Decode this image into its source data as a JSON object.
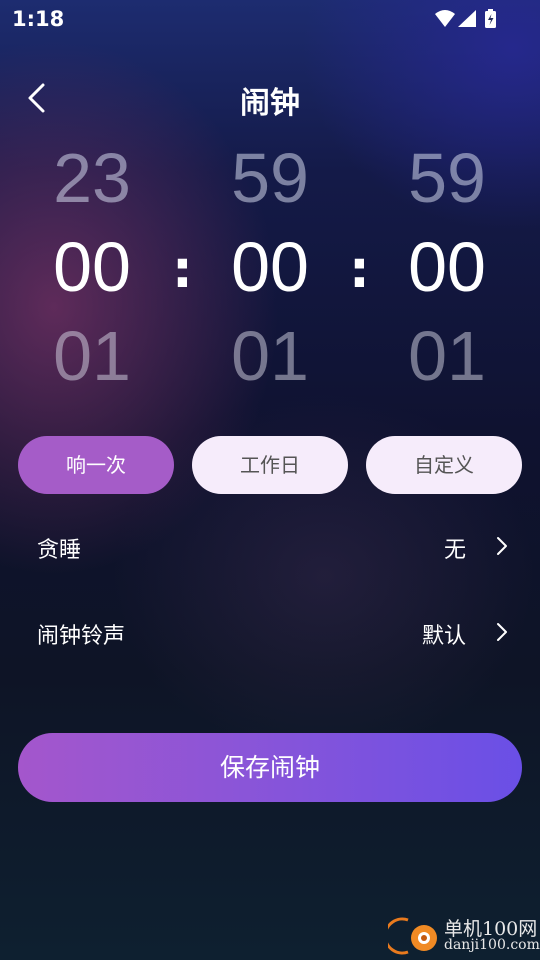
{
  "status_bar": {
    "time": "1:18",
    "icons": [
      "wifi-icon",
      "signal-icon",
      "battery-charging-icon"
    ]
  },
  "header": {
    "title": "闹钟",
    "back_icon": "chevron-left-icon"
  },
  "picker": {
    "hours": {
      "prev": "23",
      "current": "00",
      "next": "01"
    },
    "minutes": {
      "prev": "59",
      "current": "00",
      "next": "01"
    },
    "seconds": {
      "prev": "59",
      "current": "00",
      "next": "01"
    },
    "separator": ":"
  },
  "repeat_modes": [
    {
      "label": "响一次",
      "selected": true
    },
    {
      "label": "工作日",
      "selected": false
    },
    {
      "label": "自定义",
      "selected": false
    }
  ],
  "settings": {
    "snooze": {
      "label": "贪睡",
      "value": "无"
    },
    "ringtone": {
      "label": "闹钟铃声",
      "value": "默认"
    }
  },
  "save_button": {
    "label": "保存闹钟"
  },
  "watermark": {
    "line1": "单机100网",
    "line2": "danji100.com"
  },
  "colors": {
    "accent_active": "#a55cc8",
    "inactive_pill": "#f6ecfb",
    "save_gradient_start": "#a456cc",
    "save_gradient_end": "#6a4fe6"
  }
}
